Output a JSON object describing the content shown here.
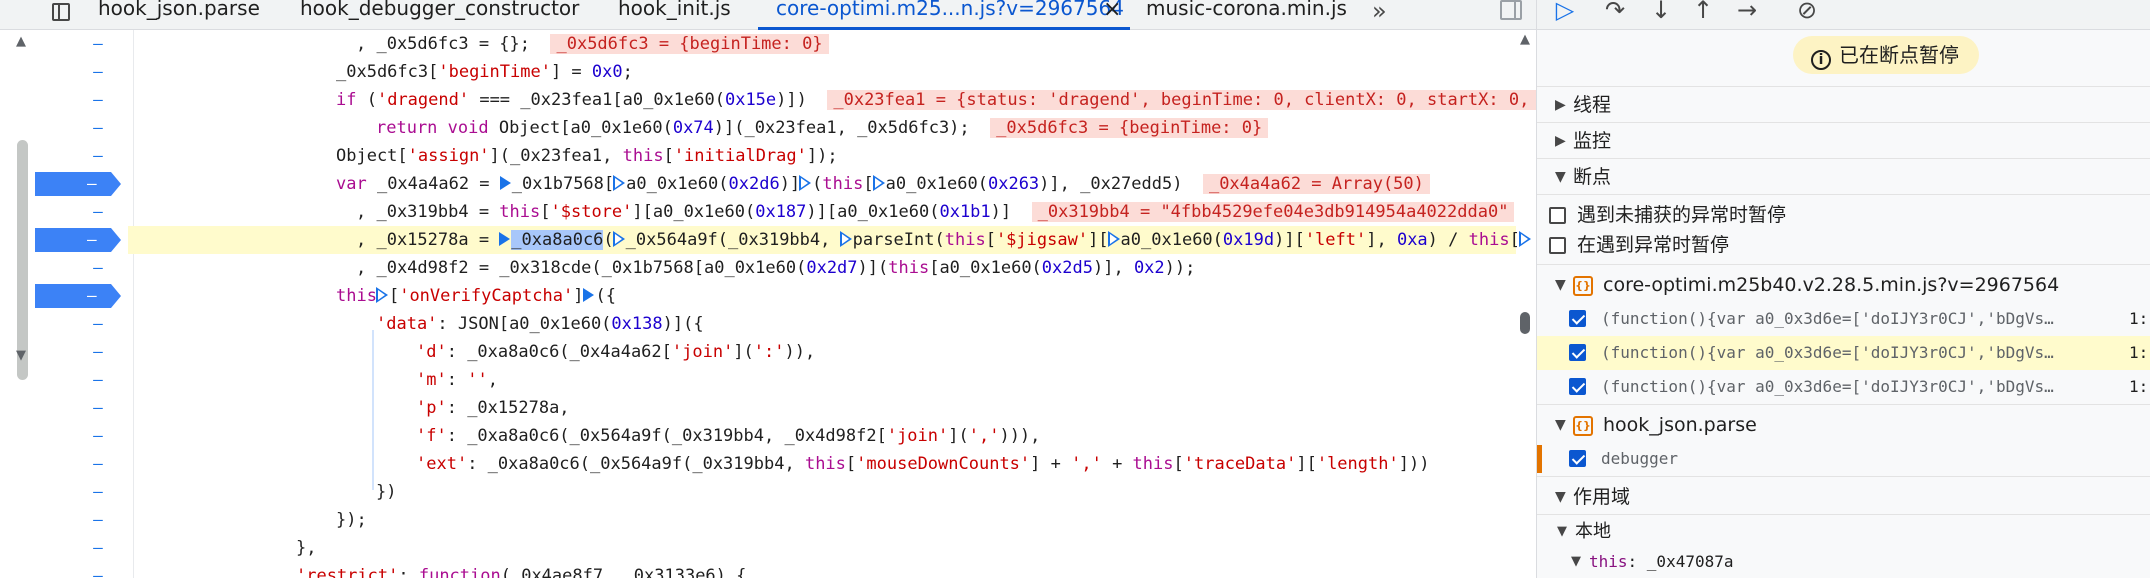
{
  "tabs": [
    {
      "label": "hook_json.parse",
      "active": false
    },
    {
      "label": "hook_debugger_constructor",
      "active": false
    },
    {
      "label": "hook_init.js",
      "active": false
    },
    {
      "label": "core-optimi.m25...n.js?v=2967564",
      "active": true
    },
    {
      "label": "music-corona.min.js",
      "active": false
    }
  ],
  "tab_close": "×",
  "tab_more": "»",
  "gutter_dash": "–",
  "code": {
    "l1": {
      "a": ", _0x5d6fc3 = {};",
      "v": "_0x5d6fc3 = {beginTime: 0}"
    },
    "l2": {
      "a": "_0x5d6fc3[",
      "s": "'beginTime'",
      "b": "] = ",
      "n": "0x0",
      "c": ";"
    },
    "l3": {
      "k": "if",
      "a": " (",
      "s": "'dragend'",
      "b": " === _0x23fea1[a0_0x1e60(",
      "n": "0x15e",
      "c": ")])",
      "v": "_0x23fea1 = {status: 'dragend', beginTime: 0, clientX: 0, startX: 0, c"
    },
    "l4": {
      "k": "return void",
      "a": " Object[a0_0x1e60(",
      "n": "0x74",
      "b": ")](_0x23fea1, _0x5d6fc3);",
      "v": "_0x5d6fc3 = {beginTime: 0}"
    },
    "l5": {
      "a": "Object[",
      "s": "'assign'",
      "b": "](_0x23fea1, ",
      "k": "this",
      "c": "[",
      "s2": "'initialDrag'",
      "d": "]);"
    },
    "l6": {
      "k": "var",
      "a": " _0x4a4a62 = ",
      "b": "_0x1b7568[",
      "c": "a0_0x1e60(",
      "n": "0x2d6",
      "d": ")]",
      "e": "(",
      "k2": "this",
      "f": "[",
      "g": "a0_0x1e60(",
      "n2": "0x263",
      "h": ")], _0x27edd5)",
      "v": "_0x4a4a62 = Array(50)"
    },
    "l7": {
      "a": ", _0x319bb4 = ",
      "k": "this",
      "b": "[",
      "s": "'$store'",
      "c": "][a0_0x1e60(",
      "n": "0x187",
      "d": ")][a0_0x1e60(",
      "n2": "0x1b1",
      "e": ")]",
      "v": "_0x319bb4 = \"4fbb4529efe04e3db914954a4022dda0\""
    },
    "l8": {
      "a": ", _0x15278a = ",
      "hl": "_0xa8a0c6",
      "b": "(",
      "c": "_0x564a9f(_0x319bb4, ",
      "d": "parseInt(",
      "k": "this",
      "e": "[",
      "s": "'$jigsaw'",
      "f": "][",
      "g": "a0_0x1e60(",
      "n": "0x19d",
      "h": ")][",
      "s2": "'left'",
      "i": "], ",
      "n2": "0xa",
      "j": ") / ",
      "k2": "this",
      "l": "["
    },
    "l9": {
      "a": ", _0x4d98f2 = _0x318cde(_0x1b7568[a0_0x1e60(",
      "n": "0x2d7",
      "b": ")](",
      "k": "this",
      "c": "[a0_0x1e60(",
      "n2": "0x2d5",
      "d": ")], ",
      "n3": "0x2",
      "e": "));"
    },
    "l10": {
      "k": "this",
      "a": "[",
      "s": "'onVerifyCaptcha'",
      "b": "]",
      "c": "({"
    },
    "l11": {
      "s": "'data'",
      "a": ": JSON[a0_0x1e60(",
      "n": "0x138",
      "b": ")]({"
    },
    "l12": {
      "s": "'d'",
      "a": ": _0xa8a0c6(_0x4a4a62[",
      "s2": "'join'",
      "b": "](",
      "s3": "':'",
      "c": ")),"
    },
    "l13": {
      "s": "'m'",
      "a": ": ",
      "s2": "''",
      "b": ","
    },
    "l14": {
      "s": "'p'",
      "a": ": _0x15278a,"
    },
    "l15": {
      "s": "'f'",
      "a": ": _0xa8a0c6(_0x564a9f(_0x319bb4, _0x4d98f2[",
      "s2": "'join'",
      "b": "](",
      "s3": "','",
      "c": "))),"
    },
    "l16": {
      "s": "'ext'",
      "a": ": _0xa8a0c6(_0x564a9f(_0x319bb4, ",
      "k": "this",
      "b": "[",
      "s2": "'mouseDownCounts'",
      "c": "] + ",
      "s3": "','",
      "d": " + ",
      "k2": "this",
      "e": "[",
      "s4": "'traceData'",
      "f": "][",
      "s5": "'length'",
      "g": "]))"
    },
    "l17": {
      "a": "})"
    },
    "l18": {
      "a": "});"
    },
    "l19": {
      "a": "},"
    },
    "l20": {
      "s": "'restrict'",
      "a": ": ",
      "k": "function",
      "b": "(_0x4ae8f7, _0x3133e6) {"
    }
  },
  "sidebar": {
    "paused_text": "已在断点暂停",
    "paused_icon": "i",
    "sections": {
      "threads": "线程",
      "watch": "监控",
      "breakpoints": "断点",
      "scope": "作用域"
    },
    "pause_uncaught": "遇到未捕获的异常时暂停",
    "pause_caught": "在遇到异常时暂停",
    "bp_files": [
      {
        "name": "core-optimi.m25b40.v2.28.5.min.js?v=2967564",
        "items": [
          {
            "code": "(function(){var a0_0x3d6e=['doIJY3r0CJ','bDgVsRFV…",
            "line": "1:"
          },
          {
            "code": "(function(){var a0_0x3d6e=['doIJY3r0CJ','bDgVsRFV…",
            "line": "1:"
          },
          {
            "code": "(function(){var a0_0x3d6e=['doIJY3r0CJ','bDgVsRFV…",
            "line": "1:"
          }
        ]
      },
      {
        "name": "hook_json.parse",
        "items": [
          {
            "code": "debugger",
            "line": ""
          }
        ]
      }
    ],
    "scope_local": "本地",
    "scope_this_key": "this",
    "scope_this_val": "_0x47087a"
  }
}
